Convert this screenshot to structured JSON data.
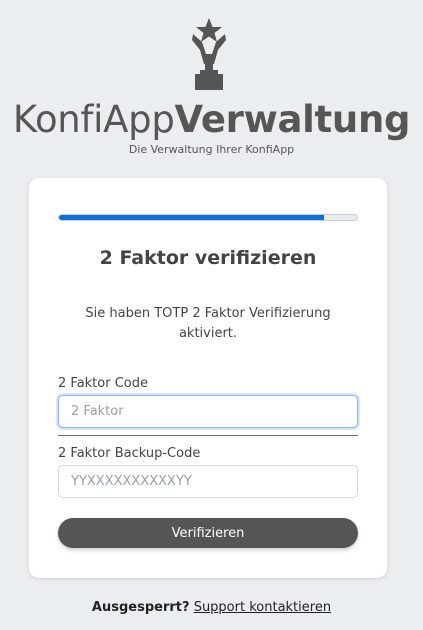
{
  "brand": {
    "logo_icon": "trophy-star-icon",
    "name_light": "KonfiApp",
    "name_bold": "Verwaltung",
    "tagline": "Die Verwaltung Ihrer KonfiApp"
  },
  "card": {
    "progress_percent": 89,
    "title": "2 Faktor verifizieren",
    "description": "Sie haben TOTP 2 Faktor Verifizierung aktiviert.",
    "code_field": {
      "label": "2 Faktor Code",
      "placeholder": "2 Faktor",
      "value": ""
    },
    "backup_field": {
      "label": "2 Faktor Backup-Code",
      "placeholder": "YYXXXXXXXXXXYY",
      "value": ""
    },
    "submit_label": "Verifizieren"
  },
  "footer": {
    "question": "Ausgesperrt?",
    "link_text": "Support kontaktieren"
  },
  "colors": {
    "background": "#ebeef0",
    "progress": "#0b6fe0",
    "button": "#555555",
    "logo": "#555555"
  }
}
